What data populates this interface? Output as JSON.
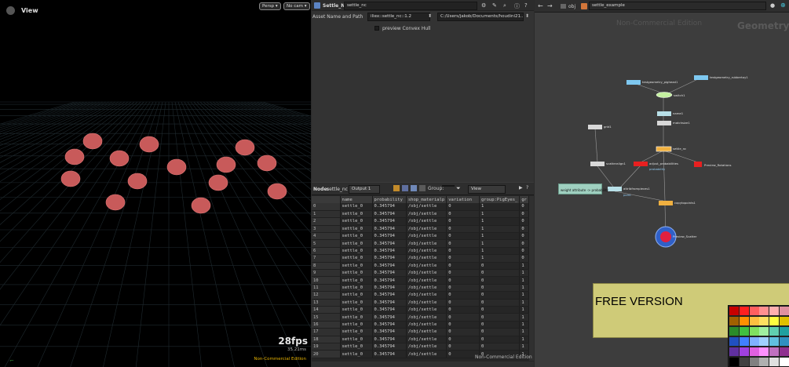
{
  "viewport": {
    "title": "View",
    "persp": "Persp ▾",
    "cam": "No cam ▾",
    "fps": "28fps",
    "ms": "35.21ms",
    "nce": "Non-Commercial Edition"
  },
  "params": {
    "node_type": "Settle_NC",
    "node_name": "settle_nc",
    "asset_label": "Asset Name and Path",
    "asset_name": "iliex::settle_nc::1.2",
    "asset_path": "C:/Users/jakob/Documents/houdini21...",
    "checkbox_label": "preview Convex Hull"
  },
  "spreadsheet": {
    "node_label": "Node:",
    "node_value": "settle_nc",
    "output": "Output 1",
    "group_label": "Group:",
    "view": "View",
    "nce": "Non-Commercial Edition",
    "columns": [
      "name",
      "probability",
      "shop_materialp",
      "variation",
      "group:PigEyes_",
      "gr"
    ],
    "rows": [
      [
        "0",
        "settle_0",
        "0.345794",
        "/obj/settle",
        "0",
        "1",
        "0"
      ],
      [
        "1",
        "settle_0",
        "0.345794",
        "/obj/settle",
        "0",
        "1",
        "0"
      ],
      [
        "2",
        "settle_0",
        "0.345794",
        "/obj/settle",
        "0",
        "1",
        "0"
      ],
      [
        "3",
        "settle_0",
        "0.345794",
        "/obj/settle",
        "0",
        "1",
        "0"
      ],
      [
        "4",
        "settle_0",
        "0.345794",
        "/obj/settle",
        "0",
        "1",
        "0"
      ],
      [
        "5",
        "settle_0",
        "0.345794",
        "/obj/settle",
        "0",
        "1",
        "0"
      ],
      [
        "6",
        "settle_0",
        "0.345794",
        "/obj/settle",
        "0",
        "1",
        "0"
      ],
      [
        "7",
        "settle_0",
        "0.345794",
        "/obj/settle",
        "0",
        "1",
        "0"
      ],
      [
        "8",
        "settle_0",
        "0.345794",
        "/obj/settle",
        "0",
        "0",
        "1"
      ],
      [
        "9",
        "settle_0",
        "0.345794",
        "/obj/settle",
        "0",
        "0",
        "1"
      ],
      [
        "10",
        "settle_0",
        "0.345794",
        "/obj/settle",
        "0",
        "0",
        "1"
      ],
      [
        "11",
        "settle_0",
        "0.345794",
        "/obj/settle",
        "0",
        "0",
        "1"
      ],
      [
        "12",
        "settle_0",
        "0.345794",
        "/obj/settle",
        "0",
        "0",
        "1"
      ],
      [
        "13",
        "settle_0",
        "0.345794",
        "/obj/settle",
        "0",
        "0",
        "1"
      ],
      [
        "14",
        "settle_0",
        "0.345794",
        "/obj/settle",
        "0",
        "0",
        "1"
      ],
      [
        "15",
        "settle_0",
        "0.345794",
        "/obj/settle",
        "0",
        "0",
        "1"
      ],
      [
        "16",
        "settle_0",
        "0.345794",
        "/obj/settle",
        "0",
        "0",
        "1"
      ],
      [
        "17",
        "settle_0",
        "0.345794",
        "/obj/settle",
        "0",
        "0",
        "1"
      ],
      [
        "18",
        "settle_0",
        "0.345794",
        "/obj/settle",
        "0",
        "0",
        "1"
      ],
      [
        "19",
        "settle_0",
        "0.345794",
        "/obj/settle",
        "0",
        "0",
        "1"
      ],
      [
        "20",
        "settle_0",
        "0.345794",
        "/obj/settle",
        "0",
        "0",
        "1"
      ]
    ]
  },
  "network": {
    "path_obj": "obj",
    "path_node": "settle_example",
    "nce": "Non-Commercial Edition",
    "context": "Geometry",
    "free": "FREE VERSION",
    "nodes": {
      "testgeo_pig": "testgeometry_pighead1",
      "testgeo_rubber": "testgeometry_rubbertoy1",
      "switch": "switch1",
      "name": "name1",
      "matchsize": "matchsize1",
      "settle": "settle_nc",
      "grid": "grid1",
      "scatter": "scatteralign1",
      "adjust": "adjust_probabilities",
      "probability": "probability",
      "attribfrom": "attribfrompieces1",
      "preview_rot": "Preview_Rotations",
      "copy": "copytopoints1",
      "preview_scatter": "Preview_Scatter",
      "sticky": "weight attribute -> probability",
      "point": "point"
    }
  }
}
